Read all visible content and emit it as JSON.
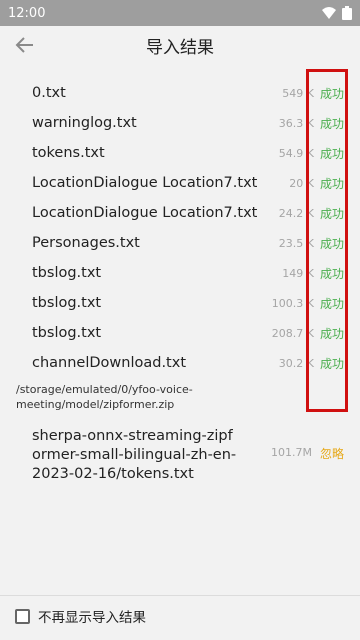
{
  "status_bar": {
    "time": "12:00",
    "wifi_icon": "wifi-icon",
    "battery_icon": "battery-icon"
  },
  "header": {
    "title": "导入结果",
    "back_icon": "arrow-left-icon"
  },
  "results": [
    {
      "name": "0.txt",
      "size": "549 K",
      "status": "成功"
    },
    {
      "name": "warninglog.txt",
      "size": "36.3 K",
      "status": "成功"
    },
    {
      "name": "tokens.txt",
      "size": "54.9 K",
      "status": "成功"
    },
    {
      "name": "LocationDialogue Location7.txt",
      "size": "20 K",
      "status": "成功"
    },
    {
      "name": "LocationDialogue Location7.txt",
      "size": "24.2 K",
      "status": "成功"
    },
    {
      "name": "Personages.txt",
      "size": "23.5 K",
      "status": "成功"
    },
    {
      "name": "tbslog.txt",
      "size": "149 K",
      "status": "成功"
    },
    {
      "name": "tbslog.txt",
      "size": "100.3 K",
      "status": "成功"
    },
    {
      "name": "tbslog.txt",
      "size": "208.7 K",
      "status": "成功"
    },
    {
      "name": "channelDownload.txt",
      "size": "30.2 K",
      "status": "成功"
    }
  ],
  "group": {
    "path": "/storage/emulated/0/yfoo-voice-meeting/model/zipformer.zip",
    "item": {
      "name": "sherpa-onnx-streaming-zipformer-small-bilingual-zh-en-2023-02-16/tokens.txt",
      "size": "101.7M",
      "status": "忽略"
    }
  },
  "footer": {
    "checkbox_label": "不再显示导入结果",
    "checked": false
  },
  "colors": {
    "success": "#4caf50",
    "ignored": "#e6a817",
    "highlight": "#d01010"
  }
}
